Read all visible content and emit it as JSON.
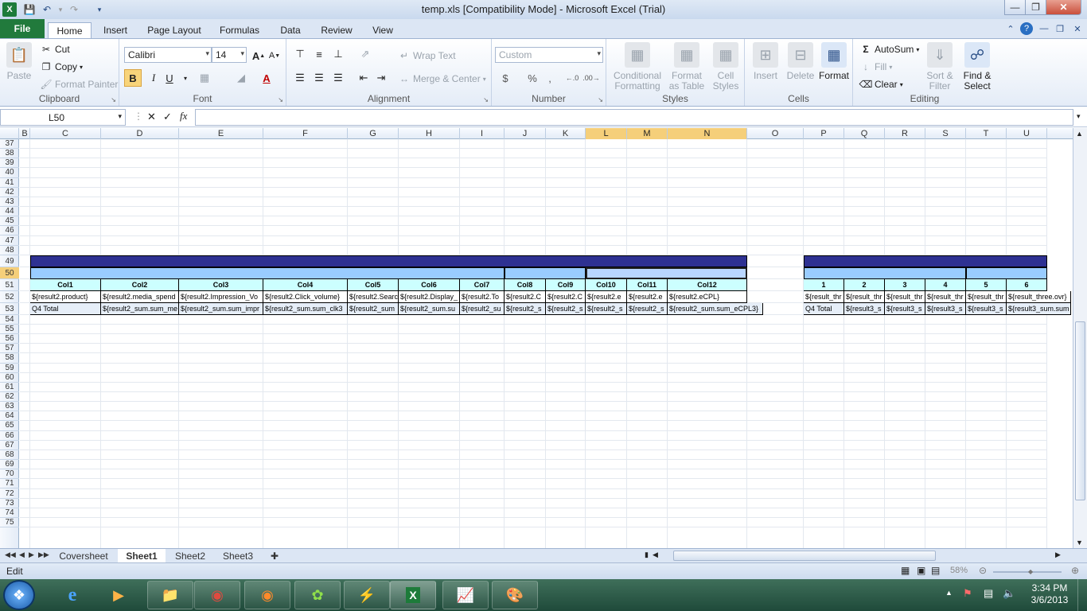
{
  "window": {
    "title": "temp.xls  [Compatibility Mode]  -  Microsoft Excel (Trial)"
  },
  "ribbon_tabs": [
    "File",
    "Home",
    "Insert",
    "Page Layout",
    "Formulas",
    "Data",
    "Review",
    "View"
  ],
  "clipboard": {
    "paste": "Paste",
    "cut": "Cut",
    "copy": "Copy",
    "format_painter": "Format Painter",
    "label": "Clipboard"
  },
  "font": {
    "name": "Calibri",
    "size": "14",
    "bold": "B",
    "italic": "I",
    "underline": "U",
    "label": "Font"
  },
  "alignment": {
    "wrap_text": "Wrap Text",
    "merge_center": "Merge & Center",
    "label": "Alignment"
  },
  "number": {
    "format": "Custom",
    "currency": "$",
    "percent": "%",
    "comma": ",",
    "label": "Number"
  },
  "styles": {
    "conditional": [
      "Conditional",
      "Formatting"
    ],
    "format_table": [
      "Format",
      "as Table"
    ],
    "cell_styles": [
      "Cell",
      "Styles"
    ],
    "label": "Styles"
  },
  "cells_group": {
    "insert": "Insert",
    "delete": "Delete",
    "format": "Format",
    "label": "Cells"
  },
  "editing": {
    "autosum": "AutoSum",
    "fill": "Fill",
    "clear": "Clear",
    "sort": [
      "Sort &",
      "Filter"
    ],
    "find": [
      "Find &",
      "Select"
    ],
    "label": "Editing"
  },
  "formula_bar": {
    "name_box": "L50",
    "fx": "fx",
    "value": ""
  },
  "columns": [
    {
      "id": "B",
      "w": 13
    },
    {
      "id": "C",
      "w": 89
    },
    {
      "id": "D",
      "w": 98
    },
    {
      "id": "E",
      "w": 106
    },
    {
      "id": "F",
      "w": 106
    },
    {
      "id": "G",
      "w": 64
    },
    {
      "id": "H",
      "w": 77
    },
    {
      "id": "I",
      "w": 56
    },
    {
      "id": "J",
      "w": 52
    },
    {
      "id": "K",
      "w": 50
    },
    {
      "id": "L",
      "w": 52
    },
    {
      "id": "M",
      "w": 51
    },
    {
      "id": "N",
      "w": 100
    },
    {
      "id": "O",
      "w": 71
    },
    {
      "id": "P",
      "w": 51
    },
    {
      "id": "Q",
      "w": 51
    },
    {
      "id": "R",
      "w": 51
    },
    {
      "id": "S",
      "w": 51
    },
    {
      "id": "T",
      "w": 51
    },
    {
      "id": "U",
      "w": 51
    }
  ],
  "selected_cols": [
    "L",
    "M",
    "N"
  ],
  "selected_row": "50",
  "rows": [
    "37",
    "38",
    "39",
    "40",
    "41",
    "42",
    "43",
    "44",
    "45",
    "46",
    "47",
    "48",
    "49",
    "50",
    "51",
    "52",
    "53",
    "54",
    "55",
    "56",
    "57",
    "58",
    "59",
    "60",
    "61",
    "62",
    "63",
    "64",
    "65",
    "66",
    "67",
    "68",
    "69",
    "70",
    "71",
    "72",
    "73",
    "74",
    "75"
  ],
  "table1": {
    "headers": [
      "Col1",
      "Col2",
      "Col3",
      "Col4",
      "Col5",
      "Col6",
      "Col7",
      "Col8",
      "Col9",
      "Col10",
      "Col11",
      "Col12"
    ],
    "row52": [
      "${result2.product}",
      "${result2.media_spend",
      "${result2.Impression_Vo",
      "${result2.Click_volume}",
      "${result2.Searc",
      "${result2.Display_",
      "${result2.To",
      "${result2.C",
      "${result2.C",
      "${result2.e",
      "${result2.e",
      "${result2.eCPL}"
    ],
    "row53": [
      "Q4 Total",
      "${result2_sum.sum_me",
      "${result2_sum.sum_impr",
      "${result2_sum.sum_clk3",
      "${result2_sum",
      "${result2_sum.su",
      "${result2_su",
      "${result2_s",
      "${result2_s",
      "${result2_s",
      "${result2_s",
      "${result2_sum.sum_eCPL3}"
    ]
  },
  "table2": {
    "headers": [
      "1",
      "2",
      "3",
      "4",
      "5",
      "6"
    ],
    "row52": [
      "${result_thr",
      "${result_thr",
      "${result_thr",
      "${result_thr",
      "${result_thr",
      "${result_three.ovr}"
    ],
    "row53": [
      "Q4 Total",
      "${result3_s",
      "${result3_s",
      "${result3_s",
      "${result3_s",
      "${result3_sum.sum"
    ]
  },
  "sheets": [
    "Coversheet",
    "Sheet1",
    "Sheet2",
    "Sheet3"
  ],
  "active_sheet": "Sheet1",
  "status": {
    "mode": "Edit",
    "zoom": "58%"
  },
  "clock": {
    "time": "3:34 PM",
    "date": "3/6/2013"
  },
  "colors": {
    "header_dark": "#2e3192",
    "header_light": "#99ccff",
    "header_cyan": "#ccffff",
    "selection": "#f5cf7a"
  }
}
